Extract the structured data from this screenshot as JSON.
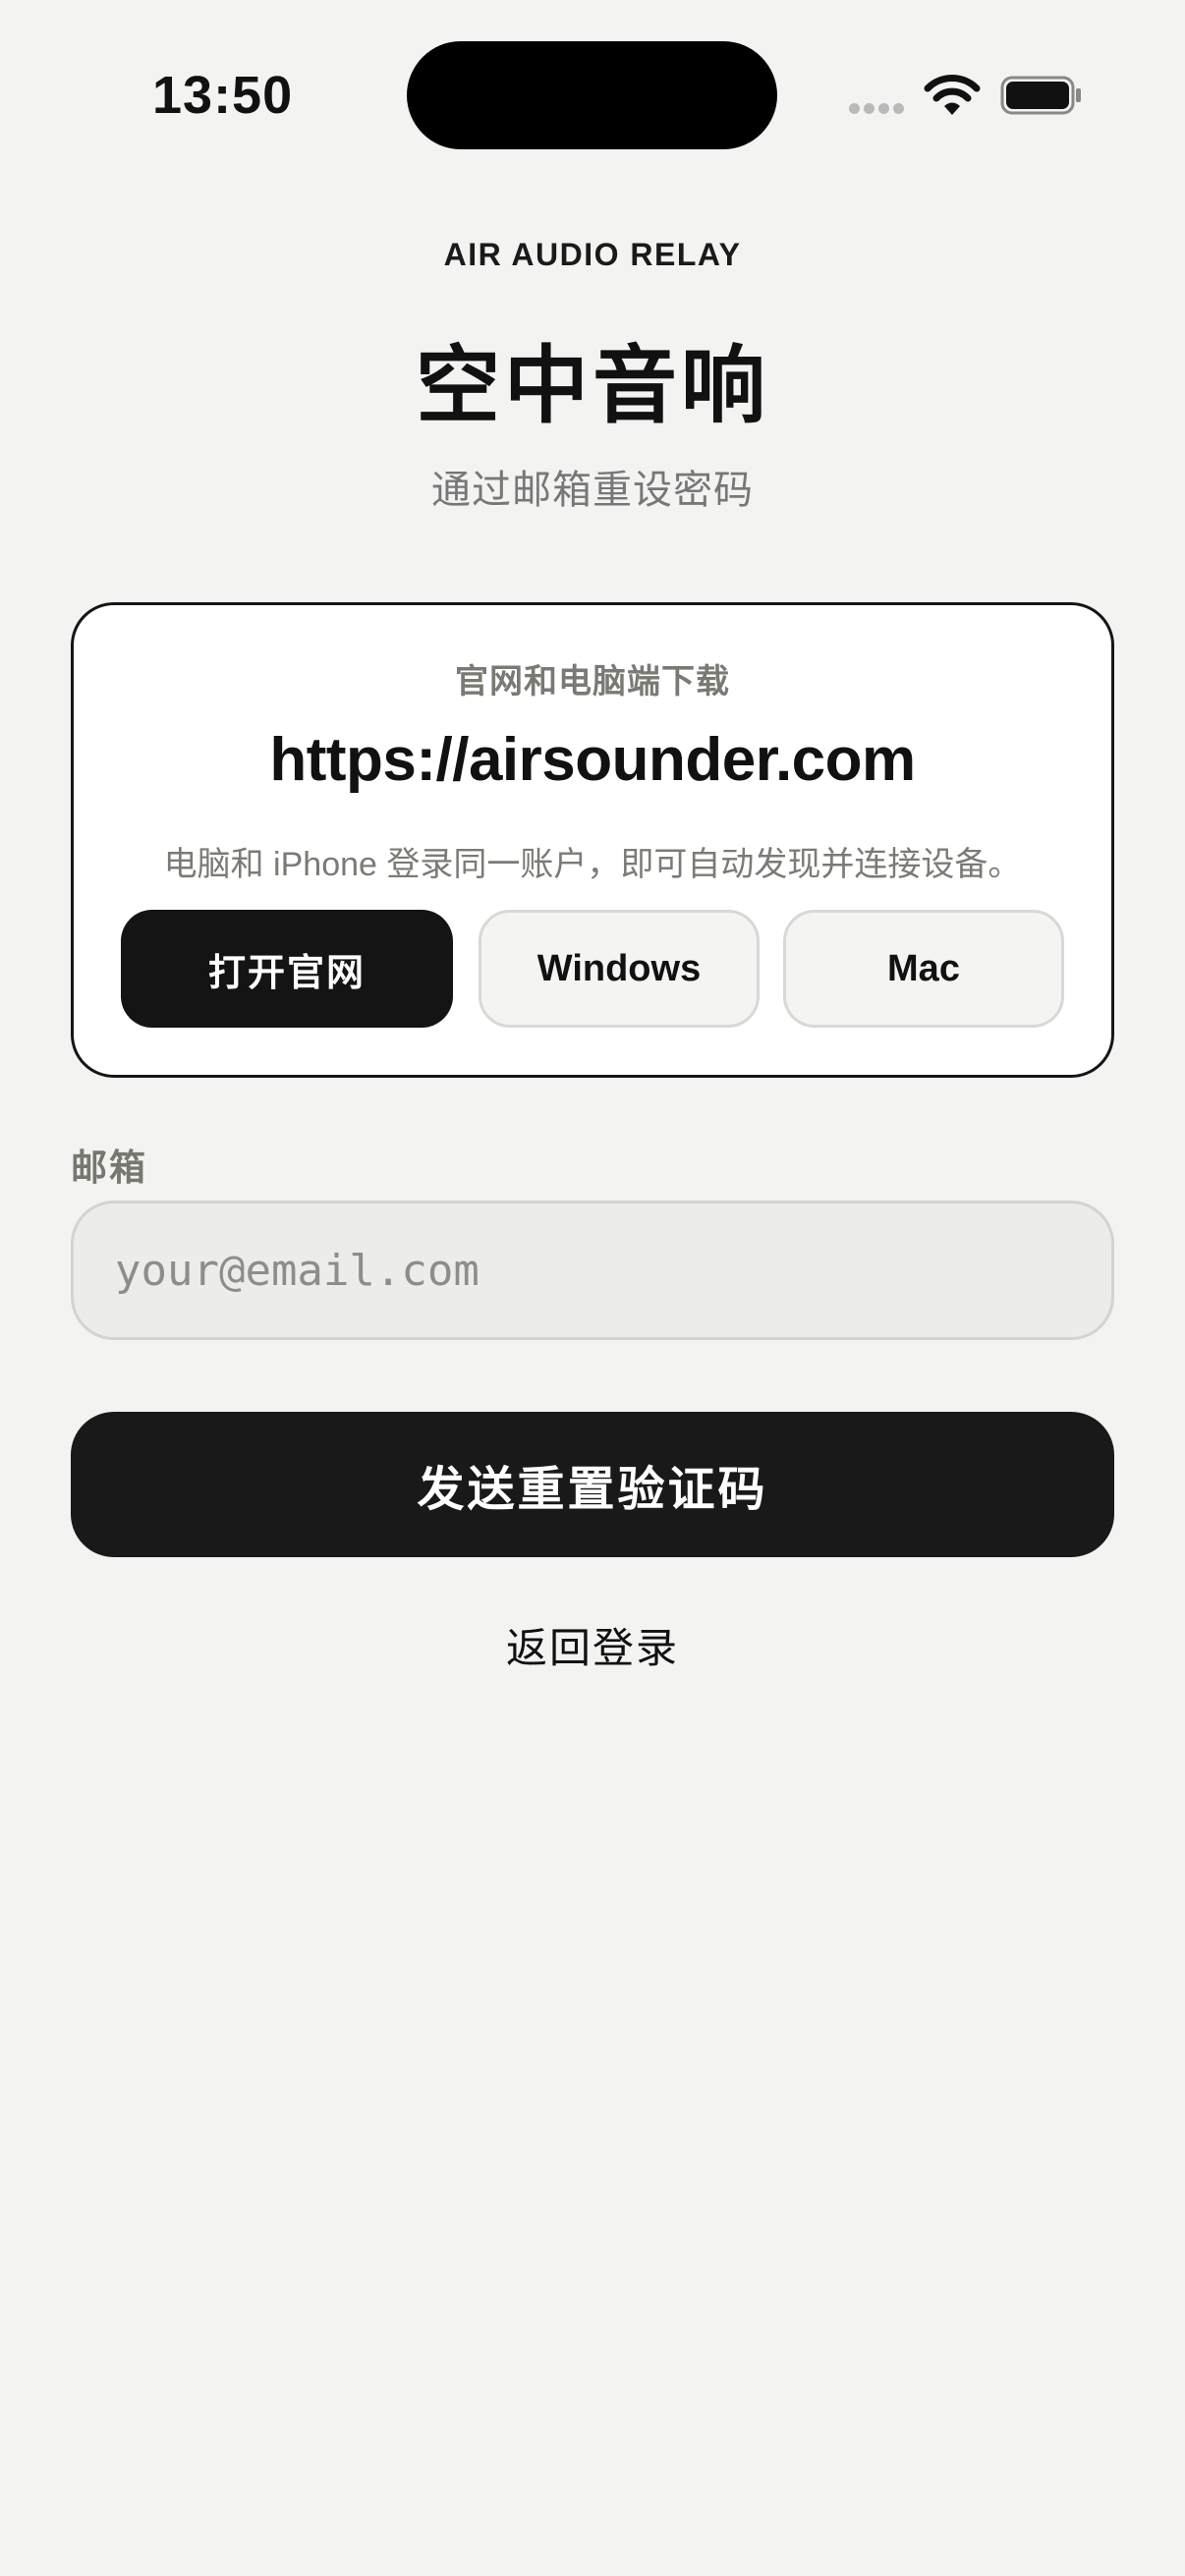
{
  "status_bar": {
    "time": "13:50",
    "wifi_icon": "wifi-icon",
    "battery_icon": "battery-icon",
    "signal_icon": "cellular-signal-dots-icon"
  },
  "header": {
    "brand": "AIR AUDIO RELAY",
    "title": "空中音响",
    "subtitle": "通过邮箱重设密码"
  },
  "download_card": {
    "label": "官网和电脑端下载",
    "url": "https://airsounder.com",
    "description": "电脑和 iPhone 登录同一账户，即可自动发现并连接设备。",
    "buttons": {
      "website": "打开官网",
      "windows": "Windows",
      "mac": "Mac"
    }
  },
  "form": {
    "email_label": "邮箱",
    "email_placeholder": "your@email.com",
    "email_value": "",
    "submit_label": "发送重置验证码",
    "back_label": "返回登录"
  },
  "colors": {
    "background": "#f3f3f2",
    "primary": "#191919",
    "muted_text": "#7a7a74",
    "card_border": "#151515"
  }
}
